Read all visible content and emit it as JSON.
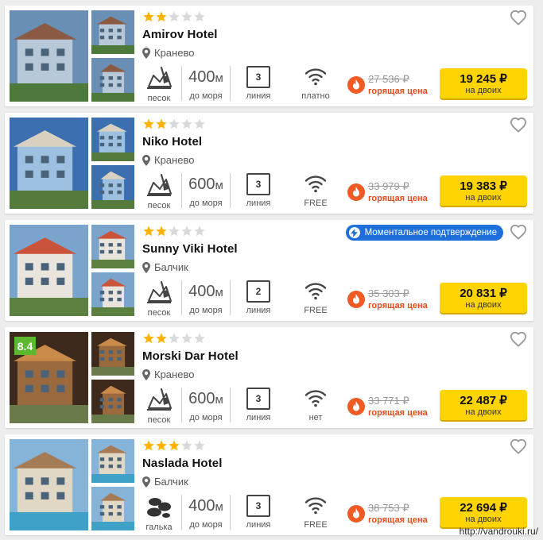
{
  "colors": {
    "star_filled": "#ffb300",
    "star_empty": "#d9d9d9",
    "price_button": "#ffd400",
    "hot_red": "#e74c1c",
    "instant_badge": "#1e6fd9",
    "rating_badge": "#5cb82d"
  },
  "hotels": [
    {
      "name": "Amirov Hotel",
      "stars": 2,
      "location": "Кранево",
      "beach_icon": "sand-beach-icon",
      "beach_label": "песок",
      "distance_num": "400",
      "distance_unit": "м",
      "distance_label": "до моря",
      "line_num": "3",
      "line_label": "линия",
      "wifi_label": "платно",
      "old_price": "27 536 ₽",
      "hot_label": "горящая цена",
      "price": "19 245 ₽",
      "price_sub": "на двоих",
      "instant": "",
      "rating": ""
    },
    {
      "name": "Niko Hotel",
      "stars": 2,
      "location": "Кранево",
      "beach_icon": "sand-beach-icon",
      "beach_label": "песок",
      "distance_num": "600",
      "distance_unit": "м",
      "distance_label": "до моря",
      "line_num": "3",
      "line_label": "линия",
      "wifi_label": "FREE",
      "old_price": "33 979 ₽",
      "hot_label": "горящая цена",
      "price": "19 383 ₽",
      "price_sub": "на двоих",
      "instant": "",
      "rating": ""
    },
    {
      "name": "Sunny Viki Hotel",
      "stars": 2,
      "location": "Балчик",
      "beach_icon": "sand-beach-icon",
      "beach_label": "песок",
      "distance_num": "400",
      "distance_unit": "м",
      "distance_label": "до моря",
      "line_num": "2",
      "line_label": "линия",
      "wifi_label": "FREE",
      "old_price": "35 303 ₽",
      "hot_label": "горящая цена",
      "price": "20 831 ₽",
      "price_sub": "на двоих",
      "instant": "Моментальное подтверждение",
      "rating": ""
    },
    {
      "name": "Morski Dar Hotel",
      "stars": 2,
      "location": "Кранево",
      "beach_icon": "sand-beach-icon",
      "beach_label": "песок",
      "distance_num": "600",
      "distance_unit": "м",
      "distance_label": "до моря",
      "line_num": "3",
      "line_label": "линия",
      "wifi_label": "нет",
      "old_price": "33 771 ₽",
      "hot_label": "горящая цена",
      "price": "22 487 ₽",
      "price_sub": "на двоих",
      "instant": "",
      "rating": "8.4"
    },
    {
      "name": "Naslada Hotel",
      "stars": 3,
      "location": "Балчик",
      "beach_icon": "pebble-beach-icon",
      "beach_label": "галька",
      "distance_num": "400",
      "distance_unit": "м",
      "distance_label": "до моря",
      "line_num": "3",
      "line_label": "линия",
      "wifi_label": "FREE",
      "old_price": "38 753 ₽",
      "hot_label": "горящая цена",
      "price": "22 694 ₽",
      "price_sub": "на двоих",
      "instant": "",
      "rating": ""
    }
  ],
  "watermark": "http://vandrouki.ru/"
}
